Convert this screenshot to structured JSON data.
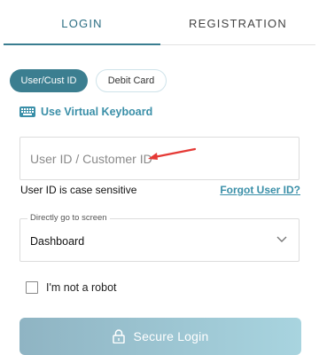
{
  "tabs": [
    {
      "label": "LOGIN",
      "active": true
    },
    {
      "label": "REGISTRATION",
      "active": false
    }
  ],
  "login_type": {
    "options": [
      "User/Cust ID",
      "Debit Card"
    ],
    "selected": "User/Cust ID"
  },
  "virtual_keyboard": {
    "label": "Use Virtual Keyboard",
    "icon": "keyboard-icon"
  },
  "user_id_field": {
    "placeholder": "User ID / Customer ID",
    "value": ""
  },
  "case_note": "User ID is case sensitive",
  "forgot_link": "Forgot User ID?",
  "screen_select": {
    "legend": "Directly go to screen",
    "value": "Dashboard"
  },
  "captcha": {
    "label": "I'm not a robot",
    "checked": false
  },
  "login_button": {
    "label": "Secure Login",
    "icon": "lock-icon"
  },
  "colors": {
    "primary": "#3b7e90",
    "link": "#3a8fa8",
    "annotation_arrow": "#e53935"
  }
}
